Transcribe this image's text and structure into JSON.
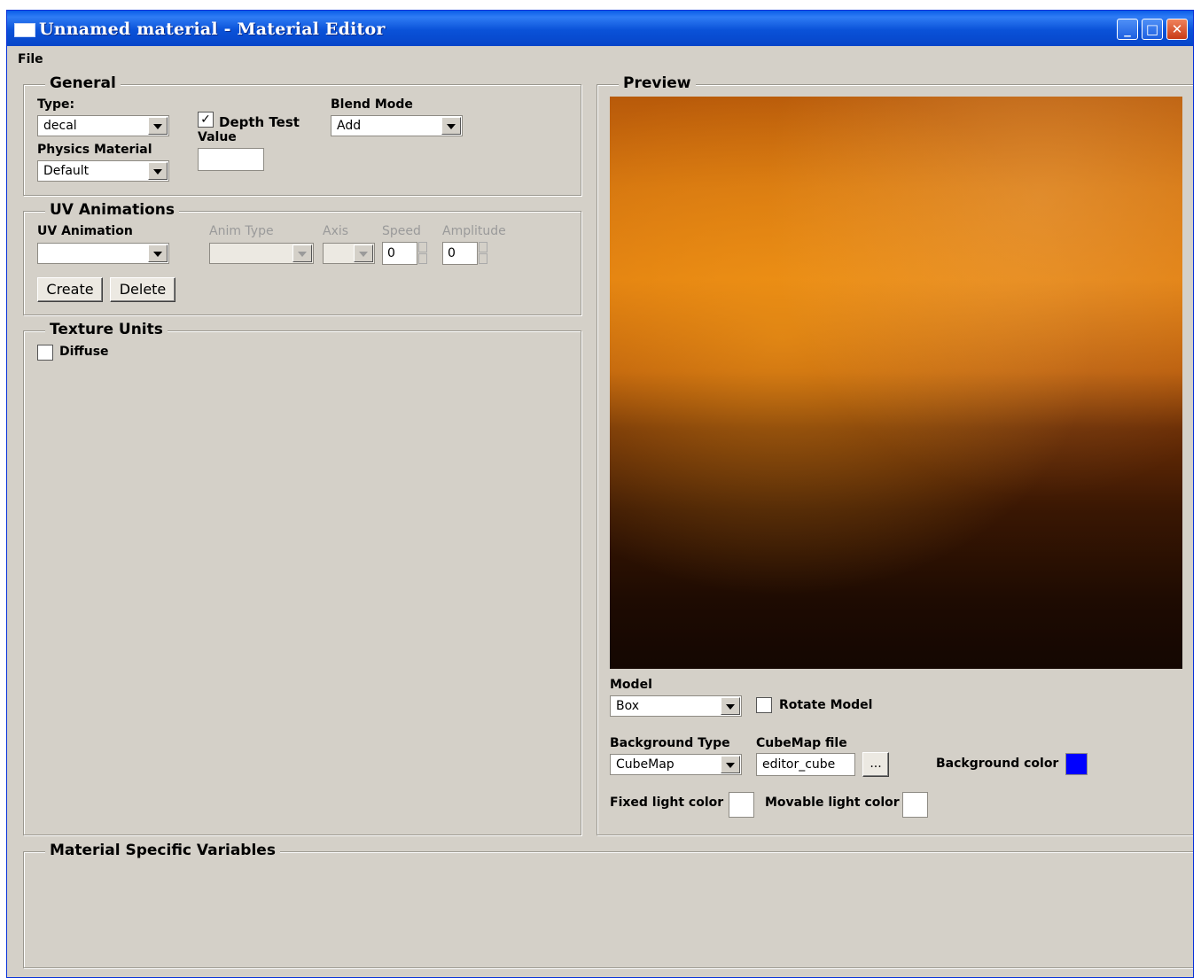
{
  "window": {
    "title": "Unnamed material - Material Editor"
  },
  "menu": {
    "file": "File"
  },
  "general": {
    "title": "General",
    "type_label": "Type:",
    "type_value": "decal",
    "physics_label": "Physics Material",
    "physics_value": "Default",
    "depth_test_label": "Depth Test",
    "depth_test_checked": true,
    "value_label": "Value",
    "value_input": "",
    "blend_label": "Blend Mode",
    "blend_value": "Add"
  },
  "uv": {
    "title": "UV Animations",
    "animation_label": "UV Animation",
    "animation_value": "",
    "anim_type_label": "Anim Type",
    "axis_label": "Axis",
    "speed_label": "Speed",
    "speed_value": "0",
    "amplitude_label": "Amplitude",
    "amplitude_value": "0",
    "create_label": "Create",
    "delete_label": "Delete"
  },
  "texture_units": {
    "title": "Texture Units",
    "diffuse_label": "Diffuse",
    "diffuse_checked": false
  },
  "preview": {
    "title": "Preview",
    "model_label": "Model",
    "model_value": "Box",
    "rotate_label": "Rotate Model",
    "rotate_checked": false,
    "bg_type_label": "Background Type",
    "bg_type_value": "CubeMap",
    "cubemap_label": "CubeMap file",
    "cubemap_value": "editor_cube",
    "browse_label": "...",
    "bg_color_label": "Background color",
    "bg_color": "#0000ff",
    "fixed_light_label": "Fixed light color",
    "fixed_light_color": "#ffffff",
    "movable_light_label": "Movable light color",
    "movable_light_color": "#ffffff"
  },
  "material_vars": {
    "title": "Material Specific Variables"
  }
}
